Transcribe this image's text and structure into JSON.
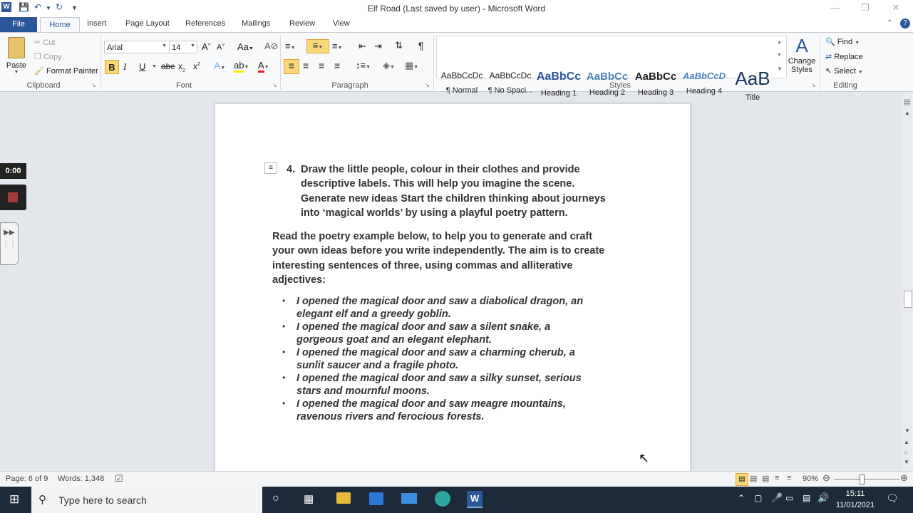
{
  "window": {
    "title": "Elf Road (Last saved by user)  -  Microsoft Word"
  },
  "tabs": [
    "File",
    "Home",
    "Insert",
    "Page Layout",
    "References",
    "Mailings",
    "Review",
    "View"
  ],
  "ribbon": {
    "clipboard": {
      "paste": "Paste",
      "cut": "Cut",
      "copy": "Copy",
      "format_painter": "Format Painter",
      "label": "Clipboard"
    },
    "font": {
      "name": "Arial",
      "size": "14",
      "label": "Font"
    },
    "paragraph": {
      "label": "Paragraph"
    },
    "styles": {
      "items": [
        {
          "sample": "AaBbCcDc",
          "name": "¶ Normal"
        },
        {
          "sample": "AaBbCcDc",
          "name": "¶ No Spaci..."
        },
        {
          "sample": "AaBbCс",
          "name": "Heading 1"
        },
        {
          "sample": "AaBbCc",
          "name": "Heading 2"
        },
        {
          "sample": "AaBbCс",
          "name": "Heading 3"
        },
        {
          "sample": "AaBbCcD",
          "name": "Heading 4"
        },
        {
          "sample": "AaB",
          "name": "Title"
        }
      ],
      "change_styles": "Change Styles",
      "label": "Styles"
    },
    "editing": {
      "find": "Find",
      "replace": "Replace",
      "select": "Select",
      "label": "Editing"
    }
  },
  "recording": {
    "timer": "0:00"
  },
  "document": {
    "item_number": "4.",
    "item_lines": [
      "Draw the little people, colour in their clothes and provide",
      "descriptive labels. This will help you imagine the scene.",
      "Generate new ideas Start the children thinking about journeys",
      "into ‘magical worlds’ by using a playful poetry pattern."
    ],
    "para_lines": [
      "Read the poetry example below, to help you to generate and craft",
      "your own ideas before you write independently. The aim is to create",
      "interesting sentences of three, using commas and alliterative",
      "adjectives:"
    ],
    "bullets": [
      [
        "I opened the magical door and saw a diabolical dragon, an",
        "elegant elf and a greedy goblin."
      ],
      [
        "I opened the magical door and saw a silent snake, a",
        "gorgeous goat and an elegant elephant."
      ],
      [
        "I opened the magical door and saw a charming cherub, a",
        "sunlit saucer and a fragile photo."
      ],
      [
        "I opened the magical door and saw a silky sunset, serious",
        "stars and mournful moons."
      ],
      [
        "I opened the magical door and saw meagre mountains,",
        "ravenous rivers and ferocious forests."
      ]
    ]
  },
  "status": {
    "page": "Page: 6 of 9",
    "words": "Words: 1,348",
    "zoom": "90%"
  },
  "taskbar": {
    "search_placeholder": "Type here to search",
    "time": "15:11",
    "date": "11/01/2021"
  },
  "colors": {
    "accent": "#2b579a",
    "taskbar": "#1d2a3a"
  }
}
